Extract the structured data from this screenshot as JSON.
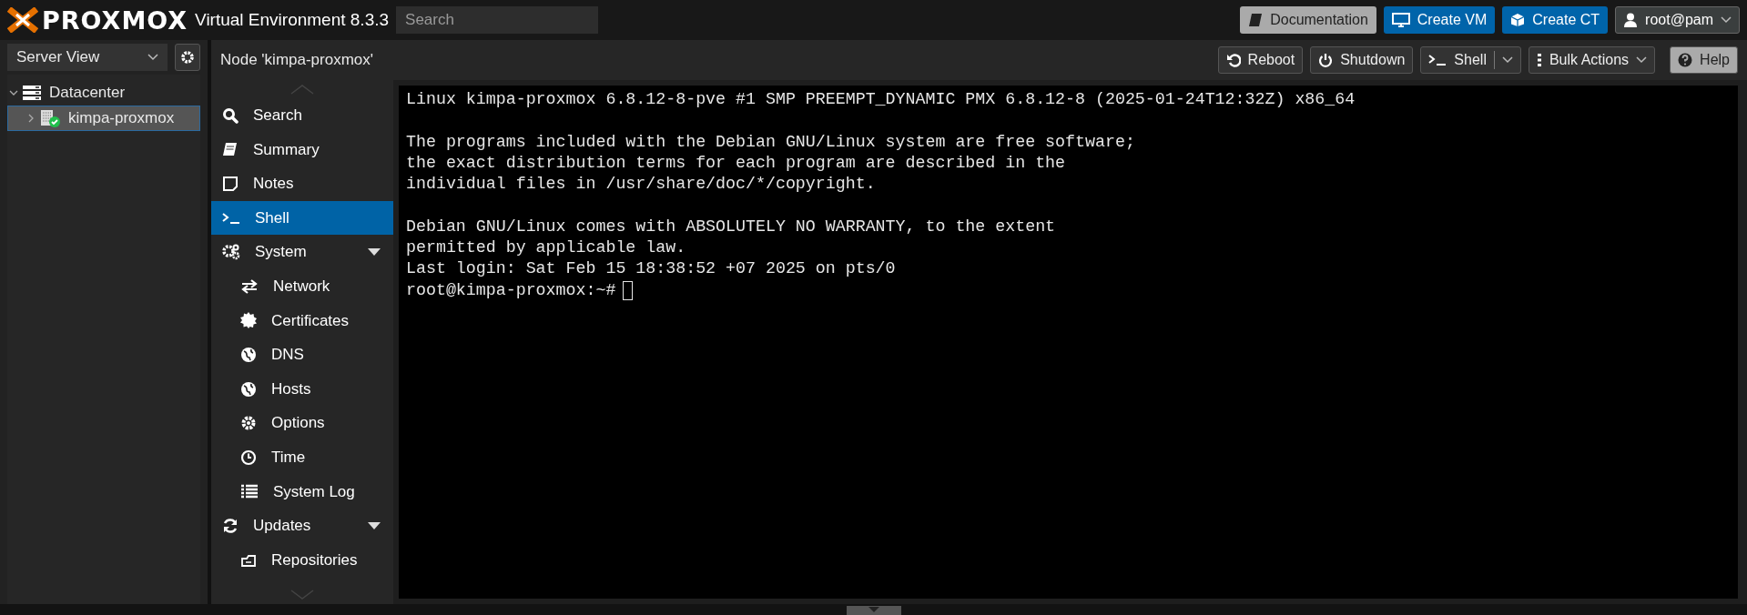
{
  "header": {
    "logo": "PROXMOX",
    "product": "Virtual Environment 8.3.3",
    "search": {
      "placeholder": "Search"
    },
    "buttons": [
      {
        "label": "Documentation",
        "kind": "doc"
      },
      {
        "label": "Create VM",
        "kind": "vm"
      },
      {
        "label": "Create CT",
        "kind": "ct"
      },
      {
        "label": "root@pam",
        "kind": "user"
      }
    ]
  },
  "sidebar": {
    "view": "Server View",
    "tree": [
      {
        "label": "Datacenter",
        "kind": "datacenter",
        "expanded": true,
        "selected": false,
        "children": [
          {
            "label": "kimpa-proxmox",
            "kind": "node",
            "expanded": false,
            "selected": true,
            "online": true
          }
        ]
      }
    ]
  },
  "content": {
    "title": "Node 'kimpa-proxmox'",
    "toolbar": [
      {
        "label": "Reboot",
        "kind": "reboot"
      },
      {
        "label": "Shutdown",
        "kind": "shutdown"
      },
      {
        "label": "Shell",
        "kind": "split"
      },
      {
        "label": "Bulk Actions",
        "kind": "menu"
      },
      {
        "label": "Help",
        "kind": "help"
      }
    ],
    "menu": [
      {
        "label": "Search",
        "selected": false
      },
      {
        "label": "Summary",
        "selected": false
      },
      {
        "label": "Notes",
        "selected": false
      },
      {
        "label": "Shell",
        "selected": true
      },
      {
        "label": "System",
        "selected": false,
        "expanded": true,
        "children": [
          {
            "label": "Network",
            "selected": false
          },
          {
            "label": "Certificates",
            "selected": false
          },
          {
            "label": "DNS",
            "selected": false
          },
          {
            "label": "Hosts",
            "selected": false
          },
          {
            "label": "Options",
            "selected": false
          },
          {
            "label": "Time",
            "selected": false
          },
          {
            "label": "System Log",
            "selected": false
          }
        ]
      },
      {
        "label": "Updates",
        "selected": false,
        "expanded": true,
        "children": [
          {
            "label": "Repositories",
            "selected": false
          }
        ]
      }
    ],
    "terminal": {
      "blocks": [
        {
          "lines": [
            "Linux kimpa-proxmox 6.8.12-8-pve #1 SMP PREEMPT_DYNAMIC PMX 6.8.12-8 (2025-01-24T12:32Z) x86_64"
          ]
        },
        {
          "lines": [
            "The programs included with the Debian GNU/Linux system are free software;",
            "the exact distribution terms for each program are described in the",
            "individual files in /usr/share/doc/*/copyright."
          ]
        },
        {
          "lines": [
            "Debian GNU/Linux comes with ABSOLUTELY NO WARRANTY, to the extent",
            "permitted by applicable law.",
            "Last login: Sat Feb 15 18:38:52 +07 2025 on pts/0"
          ]
        }
      ],
      "prompt": "root@kimpa-proxmox:~#",
      "cursor": true
    }
  }
}
